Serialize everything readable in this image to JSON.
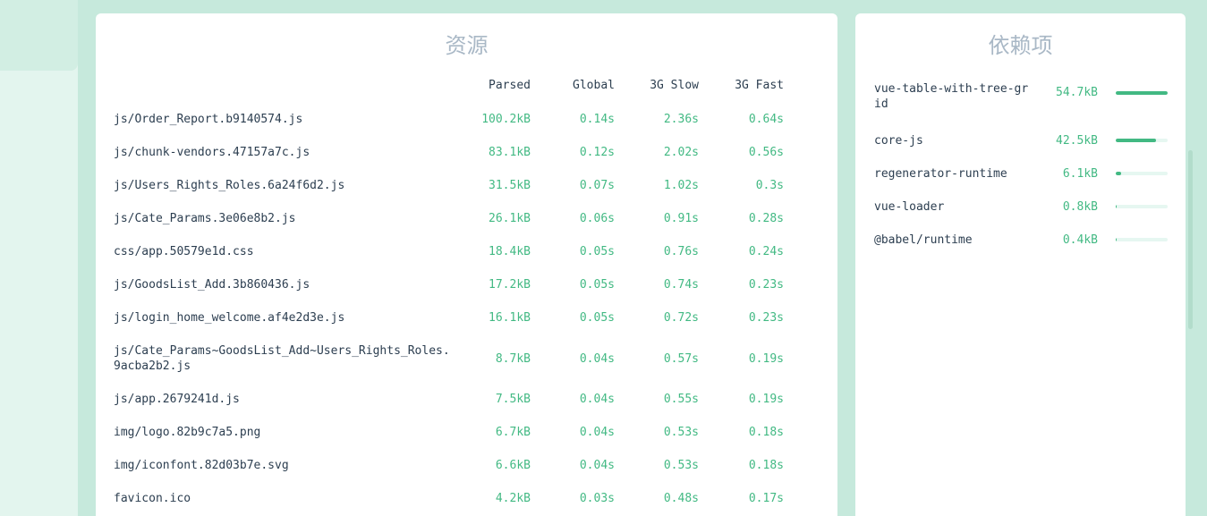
{
  "assets": {
    "title": "资源",
    "columns": [
      "Parsed",
      "Global",
      "3G Slow",
      "3G Fast"
    ],
    "rows": [
      {
        "name": "js/Order_Report.b9140574.js",
        "parsed": "100.2kB",
        "global": "0.14s",
        "slow": "2.36s",
        "fast": "0.64s"
      },
      {
        "name": "js/chunk-vendors.47157a7c.js",
        "parsed": "83.1kB",
        "global": "0.12s",
        "slow": "2.02s",
        "fast": "0.56s"
      },
      {
        "name": "js/Users_Rights_Roles.6a24f6d2.js",
        "parsed": "31.5kB",
        "global": "0.07s",
        "slow": "1.02s",
        "fast": "0.3s"
      },
      {
        "name": "js/Cate_Params.3e06e8b2.js",
        "parsed": "26.1kB",
        "global": "0.06s",
        "slow": "0.91s",
        "fast": "0.28s"
      },
      {
        "name": "css/app.50579e1d.css",
        "parsed": "18.4kB",
        "global": "0.05s",
        "slow": "0.76s",
        "fast": "0.24s"
      },
      {
        "name": "js/GoodsList_Add.3b860436.js",
        "parsed": "17.2kB",
        "global": "0.05s",
        "slow": "0.74s",
        "fast": "0.23s"
      },
      {
        "name": "js/login_home_welcome.af4e2d3e.js",
        "parsed": "16.1kB",
        "global": "0.05s",
        "slow": "0.72s",
        "fast": "0.23s"
      },
      {
        "name": "js/Cate_Params~GoodsList_Add~Users_Rights_Roles.9acba2b2.js",
        "parsed": "8.7kB",
        "global": "0.04s",
        "slow": "0.57s",
        "fast": "0.19s"
      },
      {
        "name": "js/app.2679241d.js",
        "parsed": "7.5kB",
        "global": "0.04s",
        "slow": "0.55s",
        "fast": "0.19s"
      },
      {
        "name": "img/logo.82b9c7a5.png",
        "parsed": "6.7kB",
        "global": "0.04s",
        "slow": "0.53s",
        "fast": "0.18s"
      },
      {
        "name": "img/iconfont.82d03b7e.svg",
        "parsed": "6.6kB",
        "global": "0.04s",
        "slow": "0.53s",
        "fast": "0.18s"
      },
      {
        "name": "favicon.ico",
        "parsed": "4.2kB",
        "global": "0.03s",
        "slow": "0.48s",
        "fast": "0.17s"
      }
    ]
  },
  "dependencies": {
    "title": "依赖项",
    "rows": [
      {
        "name": "vue-table-with-tree-grid",
        "size": "54.7kB",
        "ratio": 1.0
      },
      {
        "name": "core-js",
        "size": "42.5kB",
        "ratio": 0.78
      },
      {
        "name": "regenerator-runtime",
        "size": "6.1kB",
        "ratio": 0.11
      },
      {
        "name": "vue-loader",
        "size": "0.8kB",
        "ratio": 0.015
      },
      {
        "name": "@babel/runtime",
        "size": "0.4kB",
        "ratio": 0.008
      }
    ]
  },
  "colors": {
    "accent": "#42b983",
    "background": "#c6e9dc",
    "text": "#2c3e50",
    "title": "#a9b8c6"
  }
}
